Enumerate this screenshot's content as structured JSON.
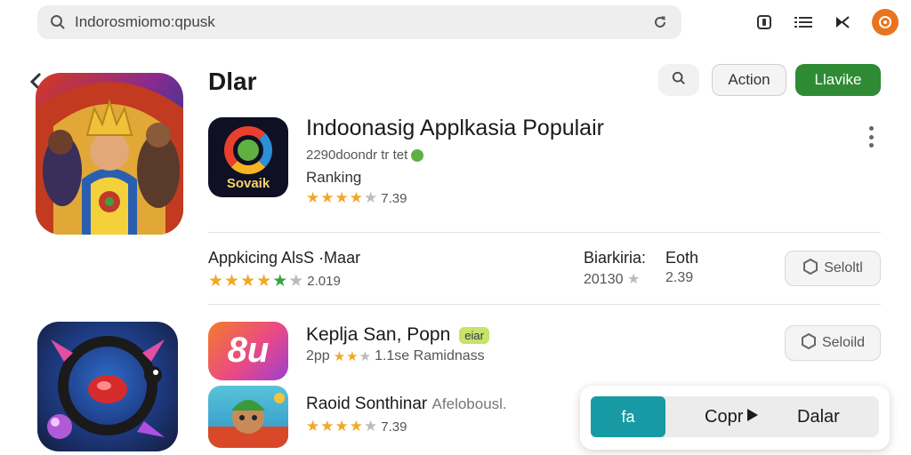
{
  "search": {
    "value": "Indorosmiomo:qpusk"
  },
  "header": {
    "title": "Dlar",
    "action_label": "Action",
    "primary_label": "Llavike"
  },
  "featured": {
    "icon_text": "Sovaik",
    "title": "Indoonasig Applkasia Populair",
    "subtitle": "2290doondr tr tet",
    "ranking_label": "Ranking",
    "rating_text": "7.39"
  },
  "section": {
    "title": "Appkicing AlsS ·Maar",
    "rating_text": "2.019",
    "col1_label": "Biarkiria:",
    "col1_value": "20130",
    "col2_label": "Eoth",
    "col2_value": "2.39",
    "button_label": "Seloltl"
  },
  "app_b": {
    "icon_text": "8u",
    "title": "Keplja San, Popn",
    "badge": "eiar",
    "subtitle": "2pp",
    "subtitle_rest": "1.1se Ramidnass",
    "button_label": "Seloild"
  },
  "app_c": {
    "title": "Raoid Sonthinar",
    "title_rest": "Afelobousl.",
    "rating_text": "7.39"
  },
  "overlay": {
    "teal_label": "fa",
    "copy_label": "Copr",
    "dalar_label": "Dalar"
  },
  "colors": {
    "accent_green": "#2e8b34",
    "accent_teal": "#179aa3",
    "star_gold": "#f0a825",
    "avatar_orange": "#e9741f"
  },
  "icons": [
    "search-icon",
    "reload-icon",
    "info-icon",
    "list-icon",
    "cast-icon",
    "avatar",
    "back-icon",
    "more-icon",
    "hexagon-icon",
    "play-icon"
  ]
}
